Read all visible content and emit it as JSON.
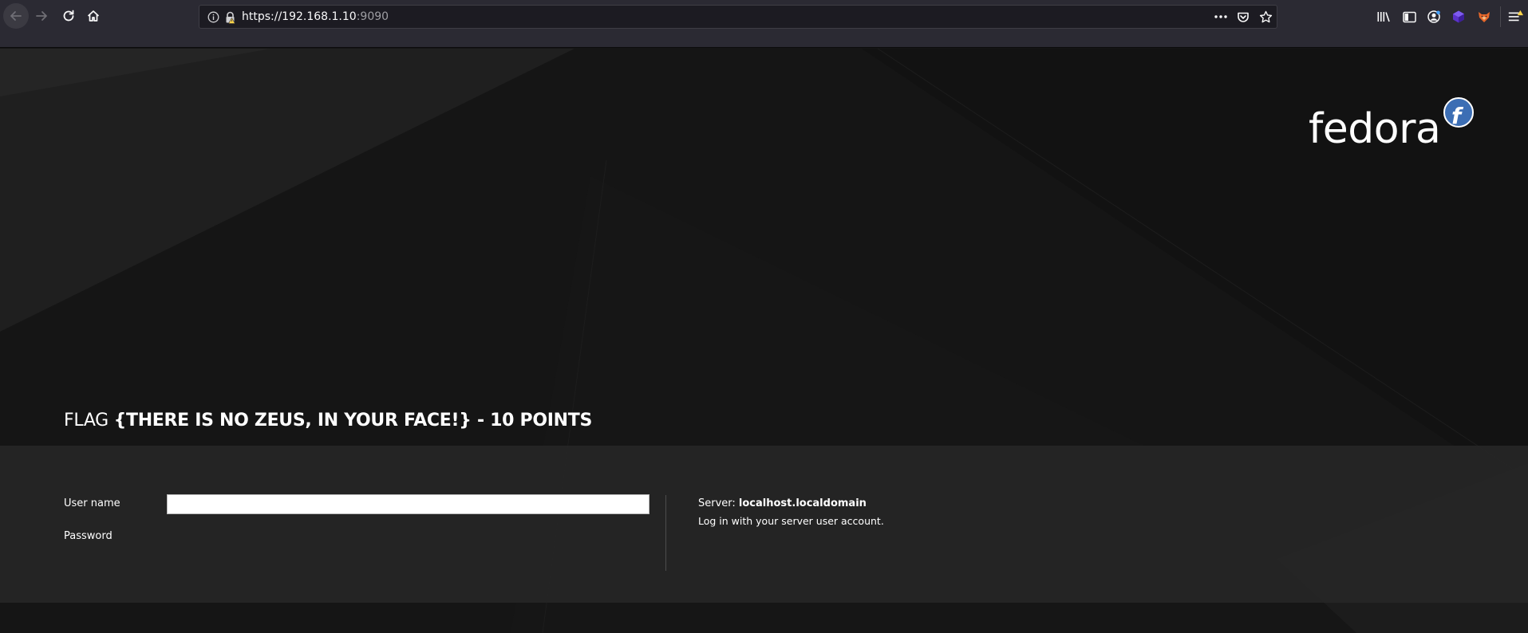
{
  "browser": {
    "url_host": "https://192.168.1.10",
    "url_port": ":9090"
  },
  "page": {
    "logo_text": "fedora",
    "flag": {
      "prefix": "FLAG ",
      "body": "{THERE IS NO ZEUS, IN YOUR FACE!} - 10 POINTS"
    },
    "login": {
      "username_label": "User name",
      "username_value": "",
      "password_label": "Password",
      "server_label": "Server: ",
      "server_name": "localhost.localdomain",
      "server_hint": "Log in with your server user account."
    }
  },
  "icons": {
    "back": "back-arrow-icon",
    "forward": "forward-arrow-icon",
    "reload": "reload-icon",
    "home": "home-icon",
    "info": "info-icon",
    "lock": "insecure-lock-icon",
    "more": "more-dots-icon",
    "pocket": "pocket-icon",
    "star": "bookmark-star-icon",
    "library": "library-icon",
    "sidebar": "sidebar-icon",
    "account": "account-icon",
    "ext1": "purple-cube-extension-icon",
    "ext2": "fox-extension-icon",
    "menu": "hamburger-menu-icon"
  },
  "colors": {
    "chrome_bg": "#2b2a33",
    "urlbar_bg": "#1c1b22",
    "page_bg": "#151515",
    "panel_bg": "#262626",
    "fedora_blue": "#3c6eb4"
  }
}
